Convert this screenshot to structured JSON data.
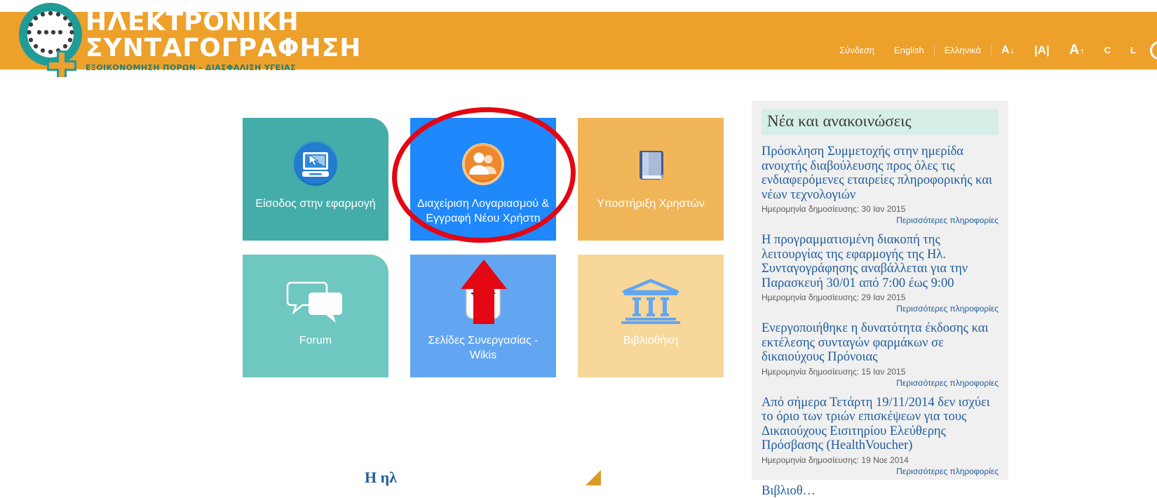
{
  "header": {
    "logo": {
      "line1": "ΗΛΕΚΤΡΟΝΙΚΗ",
      "line2": "ΣΥΝΤΑΓΟΓΡΑΦΗΣΗ",
      "tagline": "ΕΞΟΙΚΟΝΟΜΗΣΗ ΠΟΡΩΝ - ΔΙΑΣΦΑΛΙΣΗ ΥΓΕΙΑΣ"
    },
    "nav": [
      {
        "label": "Σύνδεση",
        "name": "nav-login"
      },
      {
        "label": "English",
        "name": "nav-lang-english"
      },
      {
        "label": "Ελληνικά",
        "name": "nav-lang-greek"
      }
    ],
    "font_controls": [
      {
        "label": "A",
        "arrow": "↓",
        "size": "sml",
        "name": "font-decrease"
      },
      {
        "label": "|A|",
        "arrow": "",
        "size": "mid",
        "name": "font-normal"
      },
      {
        "label": "A",
        "arrow": "↑",
        "size": "big",
        "name": "font-increase"
      }
    ],
    "contrast": [
      {
        "label": "C",
        "name": "contrast-c"
      },
      {
        "label": "L",
        "name": "contrast-l"
      }
    ],
    "bg_color": "#EDA02A"
  },
  "tiles": [
    {
      "label": "Είσοδος στην εφαρμογή",
      "icon": "monitor-cursor-icon",
      "color": "#44ACA9",
      "name": "tile-login-app"
    },
    {
      "label": "Διαχείριση Λογαριασμού & Εγγραφή Νέου Χρήστη",
      "icon": "users-group-icon",
      "color": "#1E88FC",
      "name": "tile-account-management"
    },
    {
      "label": "Υποστήριξη Χρηστών",
      "icon": "book-icon",
      "color": "#F0B559",
      "name": "tile-user-support"
    },
    {
      "label": "Forum",
      "icon": "speech-bubbles-icon",
      "color": "#6FC7C1",
      "name": "tile-forum"
    },
    {
      "label": "Σελίδες Συνεργασίας - Wikis",
      "icon": "wiki-w-icon",
      "color": "#62A6F2",
      "name": "tile-wikis"
    },
    {
      "label": "Βιβλιοθήκη",
      "icon": "classical-building-icon",
      "color": "#F7D79A",
      "name": "tile-library"
    }
  ],
  "annotations": {
    "ellipse_color": "#E30613",
    "arrow_color": "#E30613",
    "ellipse_target": "tile-account-management",
    "arrow_target": "tile-wikis"
  },
  "news": {
    "heading": "Νέα και ανακοινώσεις",
    "date_prefix": "Ημερομηνία δημοσίευσης:",
    "more_label": "Περισσότερες πληροφορίες",
    "items": [
      {
        "title": "Πρόσκληση Συμμετοχής στην ημερίδα ανοιχτής διαβούλευσης προς όλες τις ενδιαφερόμενες εταιρείες πληροφορικής και νέων τεχνολογιών",
        "date": "Ημερομηνία δημοσίευσης: 30 Ιαν 2015",
        "more": "Περισσότερες πληροφορίες"
      },
      {
        "title": "Η προγραμματισμένη διακοπή της λειτουργίας της εφαρμογής της Ηλ. Συνταγογράφησης αναβάλλεται για την Παρασκευή 30/01 από 7:00 έως 9:00",
        "date": "Ημερομηνία δημοσίευσης: 29 Ιαν 2015",
        "more": "Περισσότερες πληροφορίες"
      },
      {
        "title": "Ενεργοποιήθηκε η δυνατότητα έκδοσης και εκτέλεσης συνταγών φαρμάκων σε δικαιούχους Πρόνοιας",
        "date": "Ημερομηνία δημοσίευσης: 15 Ιαν 2015",
        "more": "Περισσότερες πληροφορίες"
      },
      {
        "title": "Από σήμερα Τετάρτη 19/11/2014 δεν ισχύει το όριο των τριών επισκέψεων για τους Δικαιούχους Εισιτηρίου Ελεύθερης Πρόσβασης (HealthVoucher)",
        "date": "Ημερομηνία δημοσίευσης: 19 Νοε 2014",
        "more": "Περισσότερες πληροφορίες"
      },
      {
        "title": "Βιβλιοθ…",
        "date": "",
        "more": ""
      }
    ]
  },
  "bottom": {
    "peek_text": "Η ηλ"
  }
}
